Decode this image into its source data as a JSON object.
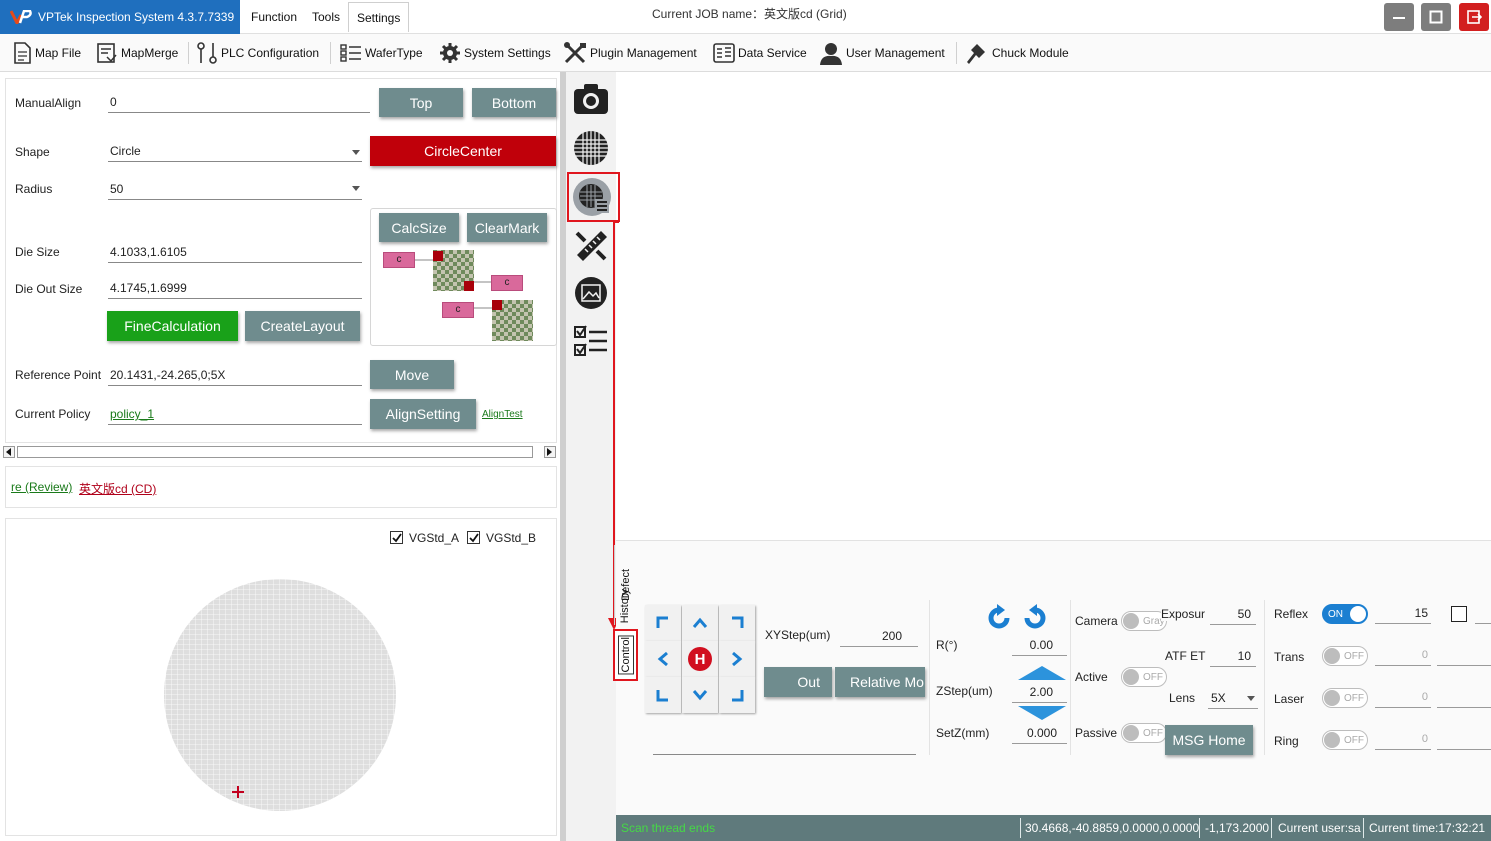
{
  "window": {
    "app_title": "VPTek Inspection System 4.3.7.7339",
    "job_name": "Current JOB name：英文版cd (Grid)"
  },
  "menu": [
    "Function",
    "Tools",
    "Settings"
  ],
  "toolbar": {
    "items": [
      "Map File",
      "MapMerge",
      "PLC Configuration",
      "WaferType",
      "System Settings",
      "Plugin Management",
      "Data Service",
      "User Management",
      "Chuck Module"
    ]
  },
  "align_panel": {
    "manual_align_label": "ManualAlign",
    "manual_align_value": "0",
    "top_button": "Top",
    "bottom_button": "Bottom",
    "shape_label": "Shape",
    "shape_value": "Circle",
    "circle_center_button": "CircleCenter",
    "radius_label": "Radius",
    "radius_value": "50",
    "die_size_label": "Die Size",
    "die_size_value": "4.1033,1.6105",
    "die_out_size_label": "Die Out Size",
    "die_out_size_value": "4.1745,1.6999",
    "fine_calc_button": "FineCalculation",
    "create_layout_button": "CreateLayout",
    "calc_size_button": "CalcSize",
    "clear_mark_button": "ClearMark",
    "diagram_box_label": "c",
    "ref_point_label": "Reference Point",
    "ref_point_value": "20.1431,-24.265,0;5X",
    "move_button": "Move",
    "policy_label": "Current Policy",
    "policy_value": "policy_1",
    "align_setting_button": "AlignSetting",
    "align_test_link": "AlignTest"
  },
  "links": {
    "review": "re (Review)",
    "job": "英文版cd (CD)"
  },
  "wafer_map": {
    "checkbox_a": "VGStd_A",
    "checkbox_b": "VGStd_B",
    "checkbox_a_checked": true,
    "checkbox_b_checked": true
  },
  "side_tabs": [
    "Defect",
    "History",
    "Control"
  ],
  "control": {
    "jog_home_label": "H",
    "xystep_label": "XYStep(um)",
    "xystep_value": "200",
    "out_button": "Out",
    "relative_button": "Relative Mo",
    "r_label": "R(°)",
    "r_value": "0.00",
    "zstep_label": "ZStep(um)",
    "zstep_value": "2.00",
    "setz_label": "SetZ(mm)",
    "setz_value": "0.000",
    "camera_label": "Camera",
    "camera_toggle": "Gray",
    "exposure_label": "Exposur",
    "exposure_value": "50",
    "atf_label": "ATF ET",
    "atf_value": "10",
    "active_label": "Active",
    "active_toggle": "OFF",
    "lens_label": "Lens",
    "lens_value": "5X",
    "passive_label": "Passive",
    "passive_toggle": "OFF",
    "msg_home_button": "MSG Home",
    "reflex_label": "Reflex",
    "reflex_toggle": "ON",
    "reflex_value": "15",
    "trans_label": "Trans",
    "trans_toggle": "OFF",
    "trans_value": "0",
    "laser_label": "Laser",
    "laser_toggle": "OFF",
    "laser_value": "0",
    "ring_label": "Ring",
    "ring_toggle": "OFF",
    "ring_value": "0"
  },
  "status": {
    "message": "Scan thread ends",
    "position": "30.4668,-40.8859,0.0000,0.0000",
    "coords": "-1,173.2000",
    "user": "Current user:sa",
    "time": "Current time:17:32:21"
  },
  "colors": {
    "brand": "#1f6fbe",
    "button_gray": "#6f8c8e",
    "button_red": "#c0000a",
    "button_green": "#19a119",
    "statusbar": "#5f7a7c",
    "highlight": "#e0161e"
  }
}
